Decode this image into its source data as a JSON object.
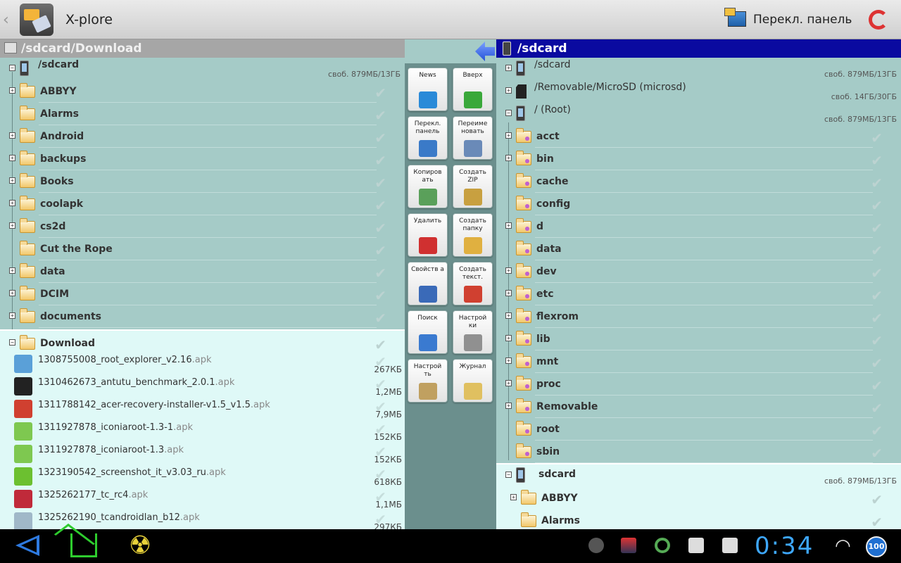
{
  "app": {
    "title": "X-plore",
    "switch_panel_label": "Перекл. панель"
  },
  "left_panel": {
    "path": "/sdcard/Download",
    "root": {
      "name": "/sdcard",
      "free": "своб. 879МБ/13ГБ"
    },
    "folders": [
      {
        "name": "ABBYY",
        "expandable": true
      },
      {
        "name": "Alarms",
        "expandable": false
      },
      {
        "name": "Android",
        "expandable": true
      },
      {
        "name": "backups",
        "expandable": true
      },
      {
        "name": "Books",
        "expandable": true
      },
      {
        "name": "coolapk",
        "expandable": true
      },
      {
        "name": "cs2d",
        "expandable": true
      },
      {
        "name": "Cut the Rope",
        "expandable": false
      },
      {
        "name": "data",
        "expandable": true
      },
      {
        "name": "DCIM",
        "expandable": true
      },
      {
        "name": "documents",
        "expandable": true
      }
    ],
    "download_folder": "Download",
    "files": [
      {
        "name": "1308755008_root_explorer_v2.16",
        "ext": ".apk",
        "size": "267КБ",
        "icon": "root-explorer-icon",
        "color": "#5aa0d8"
      },
      {
        "name": "1310462673_antutu_benchmark_2.0.1",
        "ext": ".apk",
        "size": "1,2МБ",
        "icon": "antutu-icon",
        "color": "#222222"
      },
      {
        "name": "1311788142_acer-recovery-installer-v1.5_v1.5",
        "ext": ".apk",
        "size": "7,9МБ",
        "icon": "acer-recovery-icon",
        "color": "#d04030"
      },
      {
        "name": "1311927878_iconiaroot-1.3-1",
        "ext": ".apk",
        "size": "152КБ",
        "icon": "android-apk-icon",
        "color": "#7ec850"
      },
      {
        "name": "1311927878_iconiaroot-1.3",
        "ext": ".apk",
        "size": "152КБ",
        "icon": "android-apk-icon",
        "color": "#7ec850"
      },
      {
        "name": "1323190542_screenshot_it_v3.03_ru",
        "ext": ".apk",
        "size": "618КБ",
        "icon": "screenshot-it-icon",
        "color": "#6cc030"
      },
      {
        "name": "1325262177_tc_rc4",
        "ext": ".apk",
        "size": "1,1МБ",
        "icon": "tc-icon",
        "color": "#c02a3a"
      },
      {
        "name": "1325262190_tcandroidlan_b12",
        "ext": ".apk",
        "size": "297КБ",
        "icon": "network-icon",
        "color": "#a0b8c8"
      }
    ]
  },
  "right_panel": {
    "path": "/sdcard",
    "roots": [
      {
        "name": "/sdcard",
        "free": "своб. 879МБ/13ГБ",
        "type": "phone"
      },
      {
        "name": "/Removable/MicroSD (microsd)",
        "free": "своб. 14ГБ/30ГБ",
        "type": "sdcard"
      },
      {
        "name": "/ (Root)",
        "free": "своб. 879МБ/13ГБ",
        "type": "phone"
      }
    ],
    "folders": [
      {
        "name": "acct",
        "expandable": true
      },
      {
        "name": "bin",
        "expandable": true
      },
      {
        "name": "cache",
        "expandable": false
      },
      {
        "name": "config",
        "expandable": false
      },
      {
        "name": "d",
        "expandable": true
      },
      {
        "name": "data",
        "expandable": false
      },
      {
        "name": "dev",
        "expandable": true
      },
      {
        "name": "etc",
        "expandable": true
      },
      {
        "name": "flexrom",
        "expandable": true
      },
      {
        "name": "lib",
        "expandable": true
      },
      {
        "name": "mnt",
        "expandable": true
      },
      {
        "name": "proc",
        "expandable": true
      },
      {
        "name": "Removable",
        "expandable": true
      },
      {
        "name": "root",
        "expandable": false
      },
      {
        "name": "sbin",
        "expandable": false
      }
    ],
    "lower": {
      "root": {
        "name": "sdcard",
        "free": "своб. 879МБ/13ГБ"
      },
      "folders": [
        "ABBYY",
        "Alarms"
      ]
    }
  },
  "toolbar": {
    "buttons": [
      {
        "label": "News",
        "icon": "info-icon",
        "color": "#2a8ad8"
      },
      {
        "label": "Вверх",
        "icon": "arrow-up-icon",
        "color": "#3aa83a"
      },
      {
        "label": "Перекл. панель",
        "icon": "switch-panel-icon",
        "color": "#3a7ac8"
      },
      {
        "label": "Переиме новать",
        "icon": "rename-icon",
        "color": "#6a8ab8"
      },
      {
        "label": "Копиров ать",
        "icon": "copy-icon",
        "color": "#5aa05a"
      },
      {
        "label": "Создать ZIP",
        "icon": "zip-icon",
        "color": "#c8a040"
      },
      {
        "label": "Удалить",
        "icon": "trash-icon",
        "color": "#d03030"
      },
      {
        "label": "Создать папку",
        "icon": "new-folder-icon",
        "color": "#e0b040"
      },
      {
        "label": "Свойств а",
        "icon": "properties-icon",
        "color": "#3a6ab8"
      },
      {
        "label": "Создать текст.",
        "icon": "new-text-icon",
        "color": "#d04030"
      },
      {
        "label": "Поиск",
        "icon": "search-icon",
        "color": "#3a7ad0"
      },
      {
        "label": "Настрой ки",
        "icon": "settings-icon",
        "color": "#909090"
      },
      {
        "label": "Настрой ть",
        "icon": "configure-icon",
        "color": "#c0a060"
      },
      {
        "label": "Журнал",
        "icon": "journal-icon",
        "color": "#e0c060"
      }
    ]
  },
  "status": {
    "clock": "0:34",
    "battery": "100"
  }
}
